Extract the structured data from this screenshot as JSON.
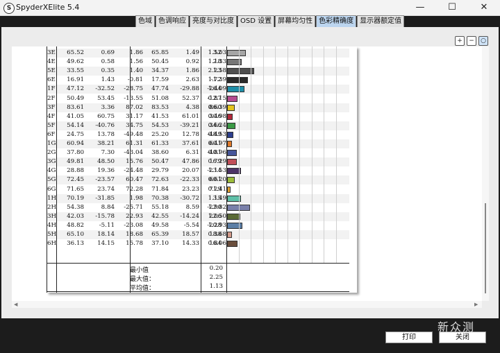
{
  "window": {
    "title": "SpyderXElite 5.4",
    "app_icon": "spyder-logo-icon",
    "minimize": "—",
    "maximize": "☐",
    "close": "✕"
  },
  "tabs": [
    {
      "label": "色域",
      "active": false
    },
    {
      "label": "色调响应",
      "active": false
    },
    {
      "label": "亮度与对比度",
      "active": false
    },
    {
      "label": "OSD 设置",
      "active": false
    },
    {
      "label": "屏幕均匀性",
      "active": false
    },
    {
      "label": "色彩精确度",
      "active": true
    },
    {
      "label": "显示器额定值",
      "active": false
    }
  ],
  "tools": {
    "zoom_in": "+",
    "zoom_out": "−",
    "zoom_fit": "○"
  },
  "table": {
    "rows": [
      {
        "id": "3E",
        "values": [
          "65.52",
          "0.69",
          "1.86",
          "65.85",
          "1.49",
          "3.03"
        ],
        "de": "1.52",
        "color": "#a6a6a6"
      },
      {
        "id": "4E",
        "values": [
          "49.62",
          "0.58",
          "1.56",
          "50.45",
          "0.92",
          "2.33"
        ],
        "de": "1.18",
        "color": "#777777"
      },
      {
        "id": "5E",
        "values": [
          "33.55",
          "0.35",
          "1.40",
          "34.37",
          "1.86",
          "1.58"
        ],
        "de": "2.23",
        "color": "#4f4f4f"
      },
      {
        "id": "6E",
        "values": [
          "16.91",
          "1.43",
          "-0.81",
          "17.59",
          "2.63",
          "-1.39"
        ],
        "de": "1.72",
        "color": "#2a2a2a"
      },
      {
        "id": "1F",
        "values": [
          "47.12",
          "-32.52",
          "-28.75",
          "47.74",
          "-29.88",
          "-26.09"
        ],
        "de": "1.44",
        "color": "#1f8ea8"
      },
      {
        "id": "2F",
        "values": [
          "50.49",
          "53.45",
          "-13.55",
          "51.08",
          "52.37",
          "-12.15"
        ],
        "de": "0.87",
        "color": "#b64a90"
      },
      {
        "id": "3F",
        "values": [
          "83.61",
          "3.36",
          "87.02",
          "83.53",
          "4.38",
          "86.39"
        ],
        "de": "0.60",
        "color": "#e4c41c"
      },
      {
        "id": "4F",
        "values": [
          "41.05",
          "60.75",
          "31.17",
          "41.53",
          "61.01",
          "30.98"
        ],
        "de": "0.46",
        "color": "#b2283a"
      },
      {
        "id": "5F",
        "values": [
          "54.14",
          "-40.76",
          "34.75",
          "54.53",
          "-39.21",
          "34.24"
        ],
        "de": "0.66",
        "color": "#3a9a45"
      },
      {
        "id": "6F",
        "values": [
          "24.75",
          "13.78",
          "-49.48",
          "25.20",
          "12.78",
          "-48.53"
        ],
        "de": "0.49",
        "color": "#2c3f8e"
      },
      {
        "id": "1G",
        "values": [
          "60.94",
          "38.21",
          "61.31",
          "61.33",
          "37.61",
          "60.97"
        ],
        "de": "0.41",
        "color": "#e07a2a"
      },
      {
        "id": "2G",
        "values": [
          "37.80",
          "7.30",
          "-43.04",
          "38.60",
          "6.31",
          "-40.96"
        ],
        "de": "0.81",
        "color": "#46569a"
      },
      {
        "id": "3G",
        "values": [
          "49.81",
          "48.50",
          "15.76",
          "50.47",
          "47.86",
          "16.29"
        ],
        "de": "0.79",
        "color": "#c04e58"
      },
      {
        "id": "4G",
        "values": [
          "28.88",
          "19.36",
          "-24.48",
          "29.79",
          "20.07",
          "-23.53"
        ],
        "de": "1.14",
        "color": "#4c3366"
      },
      {
        "id": "5G",
        "values": [
          "72.45",
          "-23.57",
          "60.47",
          "72.63",
          "-22.33",
          "60.20"
        ],
        "de": "0.61",
        "color": "#9cbc3a"
      },
      {
        "id": "6G",
        "values": [
          "71.65",
          "23.74",
          "72.28",
          "71.84",
          "23.23",
          "71.41"
        ],
        "de": "0.29",
        "color": "#e2a02c"
      },
      {
        "id": "1H",
        "values": [
          "70.19",
          "-31.85",
          "1.98",
          "70.38",
          "-30.72",
          "3.49"
        ],
        "de": "1.15",
        "color": "#5ec0a8"
      },
      {
        "id": "2H",
        "values": [
          "54.38",
          "8.84",
          "-25.71",
          "55.18",
          "8.59",
          "-22.82"
        ],
        "de": "1.90",
        "color": "#7a80aa"
      },
      {
        "id": "3H",
        "values": [
          "42.03",
          "-15.78",
          "22.93",
          "42.55",
          "-14.24",
          "22.50"
        ],
        "de": "1.06",
        "color": "#5a6a36"
      },
      {
        "id": "4H",
        "values": [
          "48.82",
          "-5.11",
          "-23.08",
          "49.58",
          "-5.54",
          "-20.93"
        ],
        "de": "1.28",
        "color": "#5c7fa6"
      },
      {
        "id": "5H",
        "values": [
          "65.10",
          "18.14",
          "18.68",
          "65.39",
          "18.57",
          "18.68"
        ],
        "de": "0.38",
        "color": "#d29a8a"
      },
      {
        "id": "6H",
        "values": [
          "36.13",
          "14.15",
          "15.78",
          "37.10",
          "14.33",
          "16.06"
        ],
        "de": "0.84",
        "color": "#6a4e3c"
      }
    ],
    "summary": [
      {
        "label": "最小值",
        "value": "0.20"
      },
      {
        "label": "最大值：",
        "value": "2.25"
      },
      {
        "label": "平均值：",
        "value": "1.13"
      }
    ]
  },
  "footer": {
    "print_label": "打印",
    "close_label": "关闭"
  },
  "watermark": "新众测"
}
